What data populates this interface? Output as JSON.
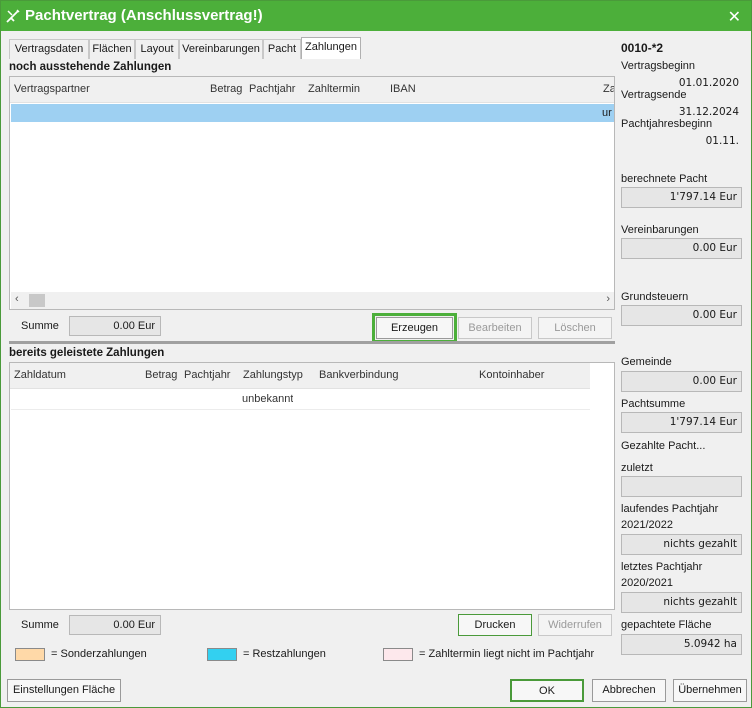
{
  "window": {
    "title": "Pachtvertrag (Anschlussvertrag!)"
  },
  "tabs": [
    {
      "label": "Vertragsdaten"
    },
    {
      "label": "Flächen"
    },
    {
      "label": "Layout"
    },
    {
      "label": "Vereinbarungen"
    },
    {
      "label": "Pacht"
    },
    {
      "label": "Zahlungen",
      "active": true
    }
  ],
  "pending": {
    "title": "noch ausstehende Zahlungen",
    "columns": [
      "Vertragspartner",
      "Betrag",
      "Pachtjahr",
      "Zahltermin",
      "IBAN",
      "Za"
    ],
    "rows": [
      {
        "partner": "",
        "betrag": "",
        "pachtjahr": "",
        "zahltermin": "",
        "iban": "",
        "trail": "ur"
      }
    ],
    "sum_label": "Summe",
    "sum_value": "0.00 Eur",
    "buttons": {
      "create": "Erzeugen",
      "edit": "Bearbeiten",
      "delete": "Löschen"
    }
  },
  "paid": {
    "title": "bereits geleistete Zahlungen",
    "columns": [
      "Zahldatum",
      "Betrag",
      "Pachtjahr",
      "Zahlungstyp",
      "Bankverbindung",
      "Kontoinhaber"
    ],
    "rows": [
      {
        "zahldatum": "",
        "betrag": "",
        "pachtjahr": "",
        "zahlungstyp": "unbekannt",
        "bank": "",
        "inhaber": ""
      }
    ],
    "sum_label": "Summe",
    "sum_value": "0.00 Eur",
    "buttons": {
      "print": "Drucken",
      "revoke": "Widerrufen"
    }
  },
  "legend": [
    {
      "color": "#ffd9a8",
      "label": "= Sonderzahlungen"
    },
    {
      "color": "#33d0f0",
      "label": "= Restzahlungen"
    },
    {
      "color": "#fde8ec",
      "label": "= Zahltermin liegt nicht im Pachtjahr"
    }
  ],
  "sidebar": {
    "contract_id": "0010-*2",
    "vertragsbeginn_label": "Vertragsbeginn",
    "vertragsbeginn": "01.01.2020",
    "vertragsende_label": "Vertragsende",
    "vertragsende": "31.12.2024",
    "pachtjahresbeginn_label": "Pachtjahresbeginn",
    "pachtjahresbeginn": "01.11.",
    "berechnete_pacht_label": "berechnete Pacht",
    "berechnete_pacht": "1'797.14 Eur",
    "vereinbarungen_label": "Vereinbarungen",
    "vereinbarungen": "0.00 Eur",
    "grundsteuern_label": "Grundsteuern",
    "grundsteuern": "0.00 Eur",
    "gemeinde_label": "Gemeinde",
    "gemeinde": "0.00 Eur",
    "pachtsumme_label": "Pachtsumme",
    "pachtsumme": "1'797.14 Eur",
    "gezahlte_pacht_label": "Gezahlte Pacht...",
    "zuletzt_label": "zuletzt",
    "zuletzt": "",
    "laufendes_label": "laufendes Pachtjahr",
    "laufendes_year": "2021/2022",
    "laufendes": "nichts gezahlt",
    "letztes_label": "letztes Pachtjahr",
    "letztes_year": "2020/2021",
    "letztes": "nichts gezahlt",
    "flaeche_label": "gepachtete Fläche",
    "flaeche": "5.0942 ha"
  },
  "footer": {
    "settings": "Einstellungen Fläche",
    "ok": "OK",
    "cancel": "Abbrechen",
    "apply": "Übernehmen"
  },
  "colors": {
    "accent": "#4caf3a",
    "selection": "#9ed0f2"
  }
}
